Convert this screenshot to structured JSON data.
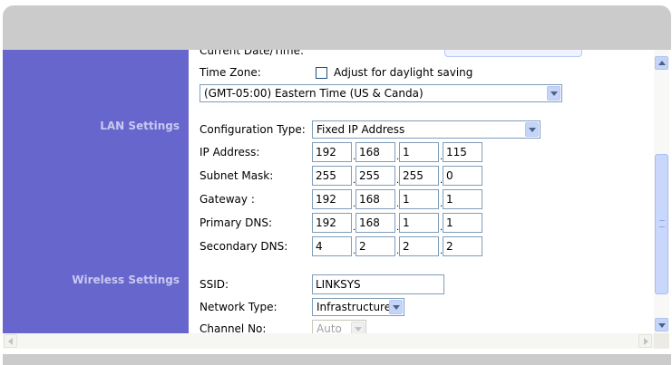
{
  "top_partial_label": "Current Date/Time:",
  "time_zone": {
    "label": "Time Zone:",
    "daylight_label": "Adjust for daylight saving",
    "daylight_checked": false,
    "selected": "(GMT-05:00) Eastern Time (US & Canda)"
  },
  "lan": {
    "section_title": "LAN Settings",
    "config_type_label": "Configuration Type:",
    "config_type_value": "Fixed IP Address",
    "rows": [
      {
        "label": "IP Address:",
        "octets": [
          "192",
          "168",
          "1",
          "115"
        ]
      },
      {
        "label": "Subnet Mask:",
        "octets": [
          "255",
          "255",
          "255",
          "0"
        ]
      },
      {
        "label": "Gateway :",
        "octets": [
          "192",
          "168",
          "1",
          "1"
        ]
      },
      {
        "label": "Primary DNS:",
        "octets": [
          "192",
          "168",
          "1",
          "1"
        ]
      },
      {
        "label": "Secondary DNS:",
        "octets": [
          "4",
          "2",
          "2",
          "2"
        ]
      }
    ]
  },
  "wireless": {
    "section_title": "Wireless Settings",
    "ssid_label": "SSID:",
    "ssid_value": "LINKSYS",
    "network_type_label": "Network Type:",
    "network_type_value": "Infrastructure",
    "channel_label": "Channel No:",
    "channel_value": "Auto"
  },
  "colors": {
    "side_panel": "#6666cc",
    "section_title": "#c8c8f2",
    "header_bar": "#cbcbcb"
  }
}
